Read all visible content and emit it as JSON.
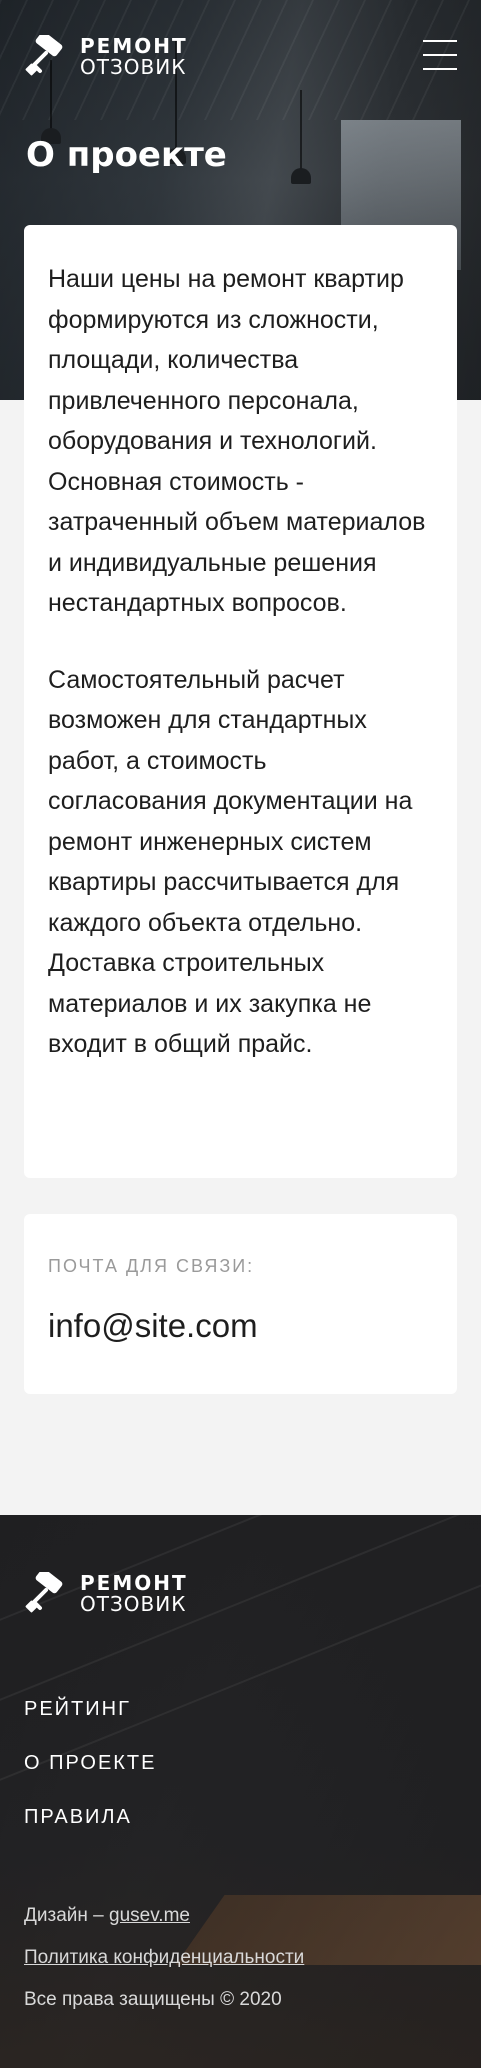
{
  "header": {
    "logo_top": "РЕМОНТ",
    "logo_bottom": "ОТЗОВИК",
    "menu_icon": "hamburger-menu-icon"
  },
  "page": {
    "title": "О проекте"
  },
  "about": {
    "paragraphs": [
      "Наши цены на ремонт квартир формируются из сложности, площади, количества привлеченного персонала, оборудования и технологий. Основная стоимость - затраченный объем материалов и индивидуальные решения нестандартных вопросов.",
      "Самостоятельный расчет возможен для стандартных работ, а стоимость согласования документации на ремонт инженерных систем квартиры рассчитывается для каждого объекта отдельно. Доставка строительных материалов и их закупка не входит в общий прайс."
    ]
  },
  "contact": {
    "label": "ПОЧТА ДЛЯ СВЯЗИ:",
    "email": "info@site.com"
  },
  "footer": {
    "logo_top": "РЕМОНТ",
    "logo_bottom": "ОТЗОВИК",
    "nav": [
      "РЕЙТИНГ",
      "О ПРОЕКТЕ",
      "ПРАВИЛА"
    ],
    "design_prefix": "Дизайн – ",
    "design_link": "gusev.me",
    "privacy_link": "Политика конфиденциальности",
    "copyright": "Все права защищены © 2020"
  },
  "colors": {
    "card_background": "#ffffff",
    "page_background": "#f3f3f3",
    "text": "#1e1e1e",
    "muted_label": "#9a9a9a"
  }
}
